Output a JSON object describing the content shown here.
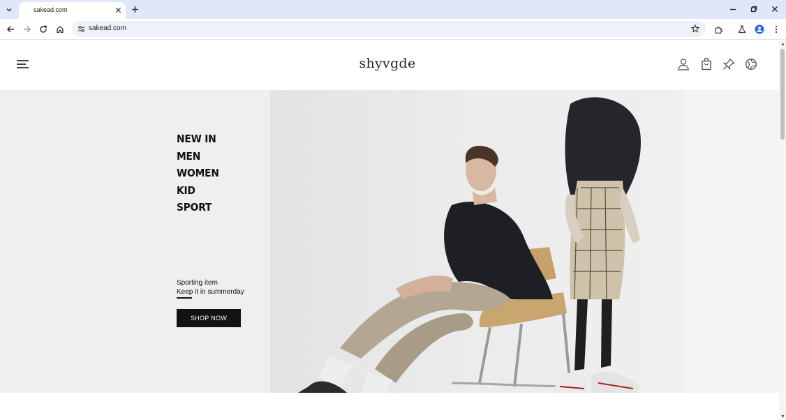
{
  "browser": {
    "tab_title": "sakead.com",
    "address": "sakead.com"
  },
  "site": {
    "logo": "shyvgde",
    "nav": [
      "NEW IN",
      "MEN",
      "WOMEN",
      "KID",
      "SPORT"
    ],
    "promo": {
      "line1": "Sporting item",
      "line2": "Keep it in summerday",
      "button": "SHOP NOW"
    },
    "header_icons": [
      "user-icon",
      "shopping-bag-icon",
      "pin-icon",
      "globe-icon"
    ]
  },
  "colors": {
    "chrome_bg": "#dfe8fb",
    "hero_bg": "#efefef",
    "button_bg": "#121212"
  }
}
